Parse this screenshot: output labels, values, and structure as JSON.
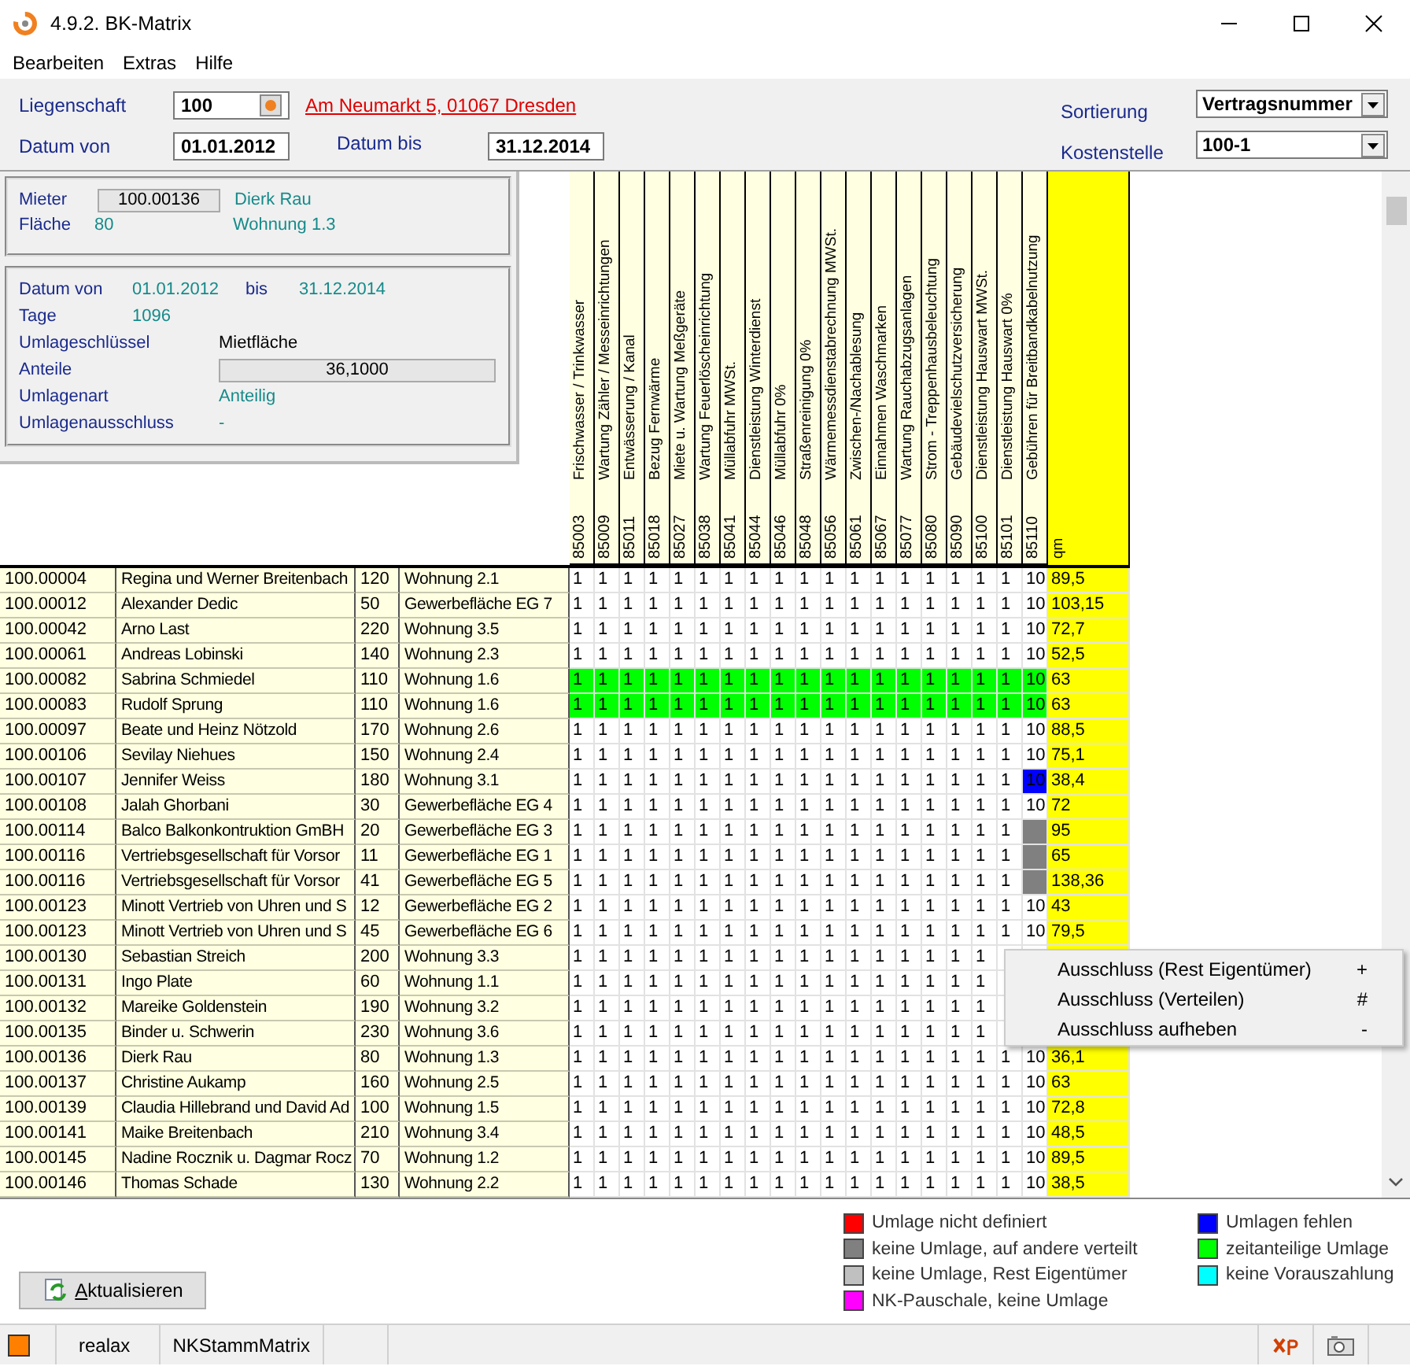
{
  "window": {
    "title": "4.9.2. BK-Matrix"
  },
  "menu": [
    "Bearbeiten",
    "Extras",
    "Hilfe"
  ],
  "filters": {
    "property_label": "Liegenschaft",
    "property": "100",
    "address": "Am Neumarkt 5, 01067 Dresden",
    "from_label": "Datum von",
    "from": "01.01.2012",
    "to_label": "Datum bis",
    "to": "31.12.2014",
    "sort_label": "Sortierung",
    "sort": "Vertragsnummer",
    "cost_center_label": "Kostenstelle",
    "cost_center": "100-1"
  },
  "tenant": {
    "tenant_label": "Mieter",
    "tenant": "100.00136",
    "name": "Dierk Rau",
    "area_label": "Fläche",
    "area": "80",
    "unit": "Wohnung 1.3"
  },
  "allocation": {
    "from_label": "Datum von",
    "from": "01.01.2012",
    "to_label": "bis",
    "to": "31.12.2014",
    "days_label": "Tage",
    "days": "1096",
    "key_label": "Umlageschlüssel",
    "key": "Mietfläche",
    "shares_label": "Anteile",
    "shares": "36,1000",
    "type_label": "Umlagenart",
    "type": "Anteilig",
    "exclusion_label": "Umlagenausschluss",
    "exclusion": "-"
  },
  "columns": [
    {
      "name": "Frischwasser / Trinkwasser",
      "code": "85003"
    },
    {
      "name": "Wartung Zähler / Messeinrichtungen",
      "code": "85009"
    },
    {
      "name": "Entwässerung / Kanal",
      "code": "85011"
    },
    {
      "name": "Bezug Fernwärme",
      "code": "85018"
    },
    {
      "name": "Miete u. Wartung Meßgeräte",
      "code": "85027"
    },
    {
      "name": "Wartung Feuerlöscheinrichtung",
      "code": "85038"
    },
    {
      "name": "Müllabfuhr MWSt.",
      "code": "85041"
    },
    {
      "name": "Dienstleistung Winterdienst",
      "code": "85044"
    },
    {
      "name": "Müllabfuhr 0%",
      "code": "85046"
    },
    {
      "name": "Straßenreinigung 0%",
      "code": "85048"
    },
    {
      "name": "Wärmemessdienstabrechnung MWSt.",
      "code": "85056"
    },
    {
      "name": "Zwischen-/Nachablesung",
      "code": "85061"
    },
    {
      "name": "Einnahmen Waschmarken",
      "code": "85067"
    },
    {
      "name": "Wartung Rauchabzugsanlagen",
      "code": "85077"
    },
    {
      "name": "Strom - Treppenhausbeleuchtung",
      "code": "85080"
    },
    {
      "name": "Gebäudevielschutzversicherung",
      "code": "85090"
    },
    {
      "name": "Dienstleistung Hauswart MWSt.",
      "code": "85100"
    },
    {
      "name": "Dienstleistung Hauswart 0%",
      "code": "85101"
    },
    {
      "name": "Gebühren für Breitbandkabelnutzung",
      "code": "85110"
    },
    {
      "name": "qm"
    }
  ],
  "rows": [
    {
      "id": "100.00004",
      "name": "Regina und Werner Breitenbach",
      "area": "120",
      "unit": "Wohnung 2.1",
      "time_share": false,
      "missing": false,
      "distributed": false,
      "cells": [
        "1",
        "1",
        "1",
        "1",
        "1",
        "1",
        "1",
        "1",
        "1",
        "1",
        "1",
        "1",
        "1",
        "1",
        "1",
        "1",
        "1",
        "1",
        "10"
      ],
      "qm": "89,5"
    },
    {
      "id": "100.00012",
      "name": "Alexander Dedic",
      "area": "50",
      "unit": "Gewerbefläche EG 7",
      "time_share": false,
      "missing": false,
      "distributed": false,
      "cells": [
        "1",
        "1",
        "1",
        "1",
        "1",
        "1",
        "1",
        "1",
        "1",
        "1",
        "1",
        "1",
        "1",
        "1",
        "1",
        "1",
        "1",
        "1",
        "10"
      ],
      "qm": "103,15"
    },
    {
      "id": "100.00042",
      "name": "Arno Last",
      "area": "220",
      "unit": "Wohnung 3.5",
      "time_share": false,
      "missing": false,
      "distributed": false,
      "cells": [
        "1",
        "1",
        "1",
        "1",
        "1",
        "1",
        "1",
        "1",
        "1",
        "1",
        "1",
        "1",
        "1",
        "1",
        "1",
        "1",
        "1",
        "1",
        "10"
      ],
      "qm": "72,7"
    },
    {
      "id": "100.00061",
      "name": "Andreas Lobinski",
      "area": "140",
      "unit": "Wohnung 2.3",
      "time_share": false,
      "missing": false,
      "distributed": false,
      "cells": [
        "1",
        "1",
        "1",
        "1",
        "1",
        "1",
        "1",
        "1",
        "1",
        "1",
        "1",
        "1",
        "1",
        "1",
        "1",
        "1",
        "1",
        "1",
        "10"
      ],
      "qm": "52,5"
    },
    {
      "id": "100.00082",
      "name": "Sabrina Schmiedel",
      "area": "110",
      "unit": "Wohnung 1.6",
      "time_share": true,
      "missing": false,
      "distributed": false,
      "cells": [
        "1",
        "1",
        "1",
        "1",
        "1",
        "1",
        "1",
        "1",
        "1",
        "1",
        "1",
        "1",
        "1",
        "1",
        "1",
        "1",
        "1",
        "1",
        "10"
      ],
      "qm": "63"
    },
    {
      "id": "100.00083",
      "name": "Rudolf Sprung",
      "area": "110",
      "unit": "Wohnung 1.6",
      "time_share": true,
      "missing": false,
      "distributed": false,
      "cells": [
        "1",
        "1",
        "1",
        "1",
        "1",
        "1",
        "1",
        "1",
        "1",
        "1",
        "1",
        "1",
        "1",
        "1",
        "1",
        "1",
        "1",
        "1",
        "10"
      ],
      "qm": "63"
    },
    {
      "id": "100.00097",
      "name": "Beate und Heinz Nötzold",
      "area": "170",
      "unit": "Wohnung 2.6",
      "time_share": false,
      "missing": false,
      "distributed": false,
      "cells": [
        "1",
        "1",
        "1",
        "1",
        "1",
        "1",
        "1",
        "1",
        "1",
        "1",
        "1",
        "1",
        "1",
        "1",
        "1",
        "1",
        "1",
        "1",
        "10"
      ],
      "qm": "88,5"
    },
    {
      "id": "100.00106",
      "name": "Sevilay Niehues",
      "area": "150",
      "unit": "Wohnung 2.4",
      "time_share": false,
      "missing": false,
      "distributed": false,
      "cells": [
        "1",
        "1",
        "1",
        "1",
        "1",
        "1",
        "1",
        "1",
        "1",
        "1",
        "1",
        "1",
        "1",
        "1",
        "1",
        "1",
        "1",
        "1",
        "10"
      ],
      "qm": "75,1"
    },
    {
      "id": "100.00107",
      "name": "Jennifer Weiss",
      "area": "180",
      "unit": "Wohnung 3.1",
      "time_share": false,
      "missing": true,
      "distributed": false,
      "cells": [
        "1",
        "1",
        "1",
        "1",
        "1",
        "1",
        "1",
        "1",
        "1",
        "1",
        "1",
        "1",
        "1",
        "1",
        "1",
        "1",
        "1",
        "1",
        "10"
      ],
      "qm": "38,4"
    },
    {
      "id": "100.00108",
      "name": "Jalah Ghorbani",
      "area": "30",
      "unit": "Gewerbefläche EG 4",
      "time_share": false,
      "missing": false,
      "distributed": false,
      "cells": [
        "1",
        "1",
        "1",
        "1",
        "1",
        "1",
        "1",
        "1",
        "1",
        "1",
        "1",
        "1",
        "1",
        "1",
        "1",
        "1",
        "1",
        "1",
        "10"
      ],
      "qm": "72"
    },
    {
      "id": "100.00114",
      "name": "Balco Balkonkontruktion GmBH",
      "area": "20",
      "unit": "Gewerbefläche EG 3",
      "time_share": false,
      "missing": false,
      "distributed": true,
      "cells": [
        "1",
        "1",
        "1",
        "1",
        "1",
        "1",
        "1",
        "1",
        "1",
        "1",
        "1",
        "1",
        "1",
        "1",
        "1",
        "1",
        "1",
        "1"
      ],
      "qm": "95"
    },
    {
      "id": "100.00116",
      "name": "Vertriebsgesellschaft für Vorsor",
      "area": "11",
      "unit": "Gewerbefläche EG 1",
      "time_share": false,
      "missing": false,
      "distributed": true,
      "cells": [
        "1",
        "1",
        "1",
        "1",
        "1",
        "1",
        "1",
        "1",
        "1",
        "1",
        "1",
        "1",
        "1",
        "1",
        "1",
        "1",
        "1",
        "1"
      ],
      "qm": "65"
    },
    {
      "id": "100.00116",
      "name": "Vertriebsgesellschaft für Vorsor",
      "area": "41",
      "unit": "Gewerbefläche EG 5",
      "time_share": false,
      "missing": false,
      "distributed": true,
      "cells": [
        "1",
        "1",
        "1",
        "1",
        "1",
        "1",
        "1",
        "1",
        "1",
        "1",
        "1",
        "1",
        "1",
        "1",
        "1",
        "1",
        "1",
        "1"
      ],
      "qm": "138,36"
    },
    {
      "id": "100.00123",
      "name": "Minott Vertrieb von Uhren und S",
      "area": "12",
      "unit": "Gewerbefläche EG 2",
      "time_share": false,
      "missing": false,
      "distributed": false,
      "cells": [
        "1",
        "1",
        "1",
        "1",
        "1",
        "1",
        "1",
        "1",
        "1",
        "1",
        "1",
        "1",
        "1",
        "1",
        "1",
        "1",
        "1",
        "1",
        "10"
      ],
      "qm": "43"
    },
    {
      "id": "100.00123",
      "name": "Minott Vertrieb von Uhren und S",
      "area": "45",
      "unit": "Gewerbefläche EG 6",
      "time_share": false,
      "missing": false,
      "distributed": false,
      "cells": [
        "1",
        "1",
        "1",
        "1",
        "1",
        "1",
        "1",
        "1",
        "1",
        "1",
        "1",
        "1",
        "1",
        "1",
        "1",
        "1",
        "1",
        "1",
        "10"
      ],
      "qm": "79,5"
    },
    {
      "id": "100.00130",
      "name": "Sebastian Streich",
      "area": "200",
      "unit": "Wohnung 3.3",
      "time_share": false,
      "cells": [
        "1",
        "1",
        "1",
        "1",
        "1",
        "1",
        "1",
        "1",
        "1",
        "1",
        "1",
        "1",
        "1",
        "1",
        "1",
        "1",
        "1"
      ]
    },
    {
      "id": "100.00131",
      "name": "Ingo Plate",
      "area": "60",
      "unit": "Wohnung 1.1",
      "time_share": false,
      "cells": [
        "1",
        "1",
        "1",
        "1",
        "1",
        "1",
        "1",
        "1",
        "1",
        "1",
        "1",
        "1",
        "1",
        "1",
        "1",
        "1",
        "1"
      ]
    },
    {
      "id": "100.00132",
      "name": "Mareike Goldenstein",
      "area": "190",
      "unit": "Wohnung 3.2",
      "time_share": false,
      "cells": [
        "1",
        "1",
        "1",
        "1",
        "1",
        "1",
        "1",
        "1",
        "1",
        "1",
        "1",
        "1",
        "1",
        "1",
        "1",
        "1",
        "1"
      ]
    },
    {
      "id": "100.00135",
      "name": "Binder u. Schwerin",
      "area": "230",
      "unit": "Wohnung 3.6",
      "time_share": false,
      "cells": [
        "1",
        "1",
        "1",
        "1",
        "1",
        "1",
        "1",
        "1",
        "1",
        "1",
        "1",
        "1",
        "1",
        "1",
        "1",
        "1",
        "1"
      ]
    },
    {
      "id": "100.00136",
      "name": "Dierk Rau",
      "area": "80",
      "unit": "Wohnung 1.3",
      "time_share": false,
      "missing": false,
      "distributed": false,
      "cells": [
        "1",
        "1",
        "1",
        "1",
        "1",
        "1",
        "1",
        "1",
        "1",
        "1",
        "1",
        "1",
        "1",
        "1",
        "1",
        "1",
        "1",
        "1",
        "10"
      ],
      "qm": "36,1"
    },
    {
      "id": "100.00137",
      "name": "Christine Aukamp",
      "area": "160",
      "unit": "Wohnung 2.5",
      "time_share": false,
      "missing": false,
      "distributed": false,
      "cells": [
        "1",
        "1",
        "1",
        "1",
        "1",
        "1",
        "1",
        "1",
        "1",
        "1",
        "1",
        "1",
        "1",
        "1",
        "1",
        "1",
        "1",
        "1",
        "10"
      ],
      "qm": "63"
    },
    {
      "id": "100.00139",
      "name": "Claudia Hillebrand und David Ad",
      "area": "100",
      "unit": "Wohnung 1.5",
      "time_share": false,
      "missing": false,
      "distributed": false,
      "cells": [
        "1",
        "1",
        "1",
        "1",
        "1",
        "1",
        "1",
        "1",
        "1",
        "1",
        "1",
        "1",
        "1",
        "1",
        "1",
        "1",
        "1",
        "1",
        "10"
      ],
      "qm": "72,8"
    },
    {
      "id": "100.00141",
      "name": "Maike Breitenbach",
      "area": "210",
      "unit": "Wohnung 3.4",
      "time_share": false,
      "missing": false,
      "distributed": false,
      "cells": [
        "1",
        "1",
        "1",
        "1",
        "1",
        "1",
        "1",
        "1",
        "1",
        "1",
        "1",
        "1",
        "1",
        "1",
        "1",
        "1",
        "1",
        "1",
        "10"
      ],
      "qm": "48,5"
    },
    {
      "id": "100.00145",
      "name": "Nadine Rocznik u. Dagmar Rocz",
      "area": "70",
      "unit": "Wohnung 1.2",
      "time_share": false,
      "missing": false,
      "distributed": false,
      "cells": [
        "1",
        "1",
        "1",
        "1",
        "1",
        "1",
        "1",
        "1",
        "1",
        "1",
        "1",
        "1",
        "1",
        "1",
        "1",
        "1",
        "1",
        "1",
        "10"
      ],
      "qm": "89,5"
    },
    {
      "id": "100.00146",
      "name": "Thomas Schade",
      "area": "130",
      "unit": "Wohnung 2.2",
      "time_share": false,
      "missing": false,
      "distributed": false,
      "cells": [
        "1",
        "1",
        "1",
        "1",
        "1",
        "1",
        "1",
        "1",
        "1",
        "1",
        "1",
        "1",
        "1",
        "1",
        "1",
        "1",
        "1",
        "1",
        "10"
      ],
      "qm": "38,5"
    }
  ],
  "context_menu": [
    {
      "label": "Ausschluss (Rest Eigentümer)",
      "shortcut": "+"
    },
    {
      "label": "Ausschluss (Verteilen)",
      "shortcut": "#"
    },
    {
      "label": "Ausschluss aufheben",
      "shortcut": "-"
    }
  ],
  "refresh_button": "Aktualisieren",
  "legend": [
    {
      "label": "Umlage nicht definiert",
      "color": "#ff0000"
    },
    {
      "label": "keine Umlage, auf andere verteilt",
      "color": "#808080"
    },
    {
      "label": "keine Umlage, Rest Eigentümer",
      "color": "#c0c0c0"
    },
    {
      "label": "NK-Pauschale, keine Umlage",
      "color": "#ff00ff"
    },
    {
      "label": "Umlagen fehlen",
      "color": "#0000ff"
    },
    {
      "label": "zeitanteilige Umlage",
      "color": "#00ff00"
    },
    {
      "label": "keine Vorauszahlung",
      "color": "#00ffff"
    }
  ],
  "status_bar": {
    "user": "realax",
    "module": "NKStammMatrix"
  }
}
